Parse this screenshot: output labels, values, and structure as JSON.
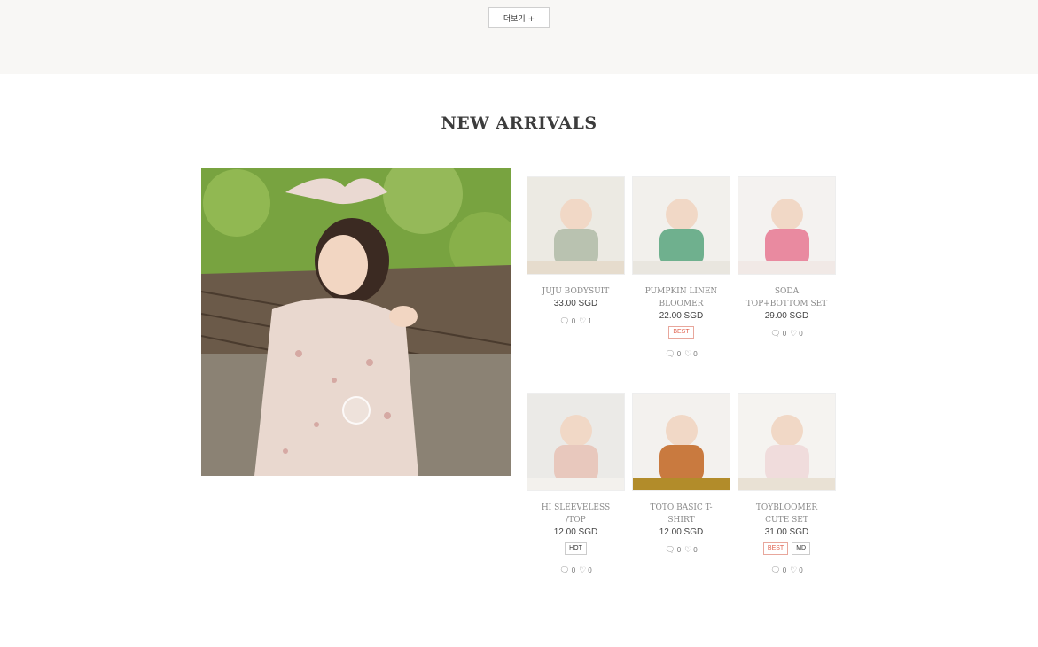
{
  "top": {
    "more_label": "더보기 +"
  },
  "section": {
    "title": "NEW ARRIVALS"
  },
  "products": [
    {
      "name": "JUJU BODYSUIT",
      "price": "33.00 SGD",
      "badges": [],
      "comments": "0",
      "likes": "1",
      "colors": [
        "#eceae3",
        "#b9c2b0",
        "#e6dccd"
      ]
    },
    {
      "name": "PUMPKIN LINEN BLOOMER",
      "price": "22.00 SGD",
      "badges": [
        "BEST"
      ],
      "comments": "0",
      "likes": "0",
      "colors": [
        "#f2f0ec",
        "#6fb08e",
        "#e9e6df"
      ]
    },
    {
      "name": "SODA TOP+BOTTOM SET",
      "price": "29.00 SGD",
      "badges": [],
      "comments": "0",
      "likes": "0",
      "colors": [
        "#f4f2f0",
        "#e98aa0",
        "#f1e9e6"
      ]
    },
    {
      "name": "HI SLEEVELESS /TOP",
      "price": "12.00 SGD",
      "badges": [
        "HOT"
      ],
      "comments": "0",
      "likes": "0",
      "colors": [
        "#ebeae7",
        "#e8c8bd",
        "#f3f1ed"
      ]
    },
    {
      "name": "TOTO BASIC T-SHIRT",
      "price": "12.00 SGD",
      "badges": [],
      "comments": "0",
      "likes": "0",
      "colors": [
        "#f3f1ee",
        "#c97a3f",
        "#b28c2a"
      ]
    },
    {
      "name": "TOYBLOOMER CUTE SET",
      "price": "31.00 SGD",
      "badges": [
        "BEST",
        "MD"
      ],
      "comments": "0",
      "likes": "0",
      "colors": [
        "#f5f3f0",
        "#f0dcdc",
        "#e9e1d4"
      ]
    }
  ]
}
